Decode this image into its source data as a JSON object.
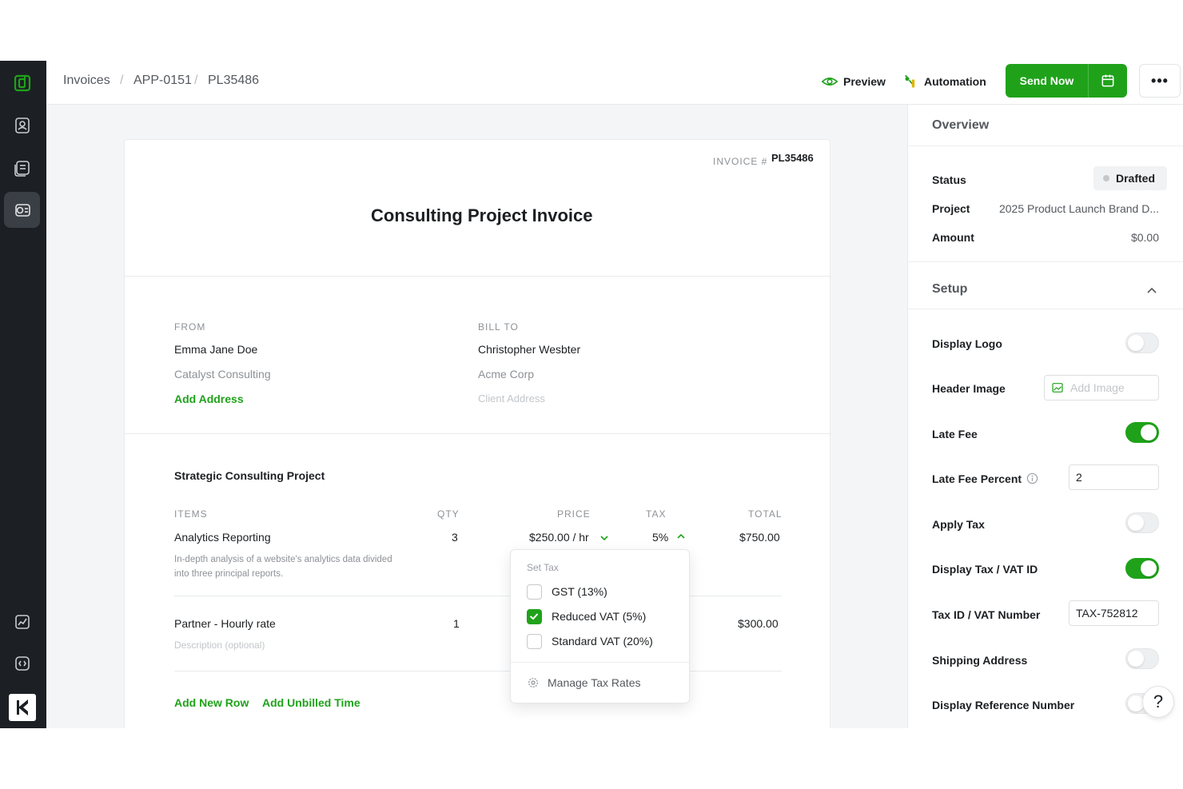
{
  "breadcrumb": [
    "Invoices",
    "APP-0151",
    "PL35486"
  ],
  "topbar": {
    "preview_label": "Preview",
    "automation_label": "Automation",
    "send_now_label": "Send Now",
    "more_label": "•••"
  },
  "invoice": {
    "number_label": "INVOICE #",
    "number": "PL35486",
    "title": "Consulting Project Invoice",
    "from": {
      "label": "FROM",
      "name": "Emma Jane Doe",
      "company": "Catalyst Consulting",
      "add_address": "Add Address"
    },
    "bill_to": {
      "label": "BILL TO",
      "name": "Christopher Wesbter",
      "company": "Acme Corp",
      "address_placeholder": "Client Address"
    },
    "project_title": "Strategic Consulting Project",
    "columns": [
      "ITEMS",
      "QTY",
      "PRICE",
      "TAX",
      "TOTAL"
    ],
    "rows": [
      {
        "item": "Analytics Reporting",
        "description": "In-depth analysis of a website's analytics data divided into three principal reports.",
        "qty": "3",
        "price": "$250.00 / hr",
        "tax": "5%",
        "total": "$750.00"
      },
      {
        "item": "Partner - Hourly rate",
        "description": "Description (optional)",
        "qty": "1",
        "price": "",
        "tax": "",
        "total": "$300.00"
      }
    ],
    "add_row": "Add New Row",
    "add_unbilled": "Add Unbilled Time"
  },
  "tax_dropdown": {
    "heading": "Set Tax",
    "options": [
      {
        "label": "GST (13%)",
        "checked": false
      },
      {
        "label": "Reduced VAT (5%)",
        "checked": true
      },
      {
        "label": "Standard VAT (20%)",
        "checked": false
      }
    ],
    "manage_label": "Manage Tax Rates"
  },
  "overview": {
    "heading": "Overview",
    "status_label": "Status",
    "status_value": "Drafted",
    "project_label": "Project",
    "project_value": "2025 Product Launch Brand D...",
    "amount_label": "Amount",
    "amount_value": "$0.00"
  },
  "setup": {
    "heading": "Setup",
    "display_logo": "Display Logo",
    "header_image": "Header Image",
    "add_image_placeholder": "Add Image",
    "late_fee": "Late Fee",
    "late_fee_percent": "Late Fee Percent",
    "late_fee_percent_value": "2",
    "apply_tax": "Apply Tax",
    "display_tax_id": "Display Tax / VAT ID",
    "tax_id_label": "Tax ID / VAT Number",
    "tax_id_value": "TAX-752812",
    "shipping_address": "Shipping Address",
    "display_reference": "Display Reference Number"
  },
  "help_label": "?",
  "colors": {
    "accent": "#1fa21a",
    "sidebar": "#1c2024"
  }
}
